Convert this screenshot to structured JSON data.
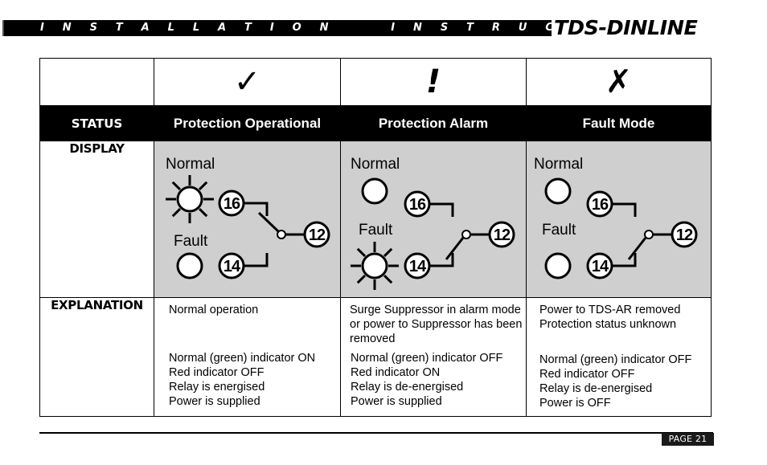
{
  "header": {
    "title": "I N S T A L L A T I O N     I N S T R U C T I O N S",
    "brand": "TDS-DINLINE"
  },
  "table": {
    "row_labels": {
      "status": "STATUS",
      "display": "DISPLAY",
      "explanation": "EXPLANATION"
    },
    "columns": [
      {
        "icon": "check-mark-icon",
        "icon_glyph": "✓",
        "status": "Protection Operational",
        "display": {
          "normal_label": "Normal",
          "fault_label": "Fault",
          "normal_indicator": "on",
          "fault_indicator": "off",
          "relay_contact": "16-12",
          "terminals": [
            "16",
            "12",
            "14"
          ]
        },
        "explanation": {
          "summary": [
            "Normal operation"
          ],
          "details": [
            "Normal (green) indicator ON",
            "Red indicator OFF",
            "Relay is energised",
            "Power is supplied"
          ]
        }
      },
      {
        "icon": "exclamation-icon",
        "icon_glyph": "!",
        "status": "Protection Alarm",
        "display": {
          "normal_label": "Normal",
          "fault_label": "Fault",
          "normal_indicator": "off",
          "fault_indicator": "on",
          "relay_contact": "14-12",
          "terminals": [
            "16",
            "12",
            "14"
          ]
        },
        "explanation": {
          "summary": [
            "Surge Suppressor in alarm mode",
            "or power to Suppressor has been",
            "removed"
          ],
          "details": [
            "Normal (green) indicator OFF",
            "Red indicator ON",
            "Relay is de-energised",
            "Power is supplied"
          ]
        }
      },
      {
        "icon": "cross-mark-icon",
        "icon_glyph": "✗",
        "status": "Fault Mode",
        "display": {
          "normal_label": "Normal",
          "fault_label": "Fault",
          "normal_indicator": "off",
          "fault_indicator": "off",
          "relay_contact": "14-12",
          "terminals": [
            "16",
            "12",
            "14"
          ]
        },
        "explanation": {
          "summary": [
            "Power to TDS-AR removed",
            "Protection status unknown"
          ],
          "details": [
            "Normal (green) indicator OFF",
            "Red indicator OFF",
            "Relay is de-energised",
            "Power is OFF"
          ]
        }
      }
    ]
  },
  "footer": {
    "page_label": "PAGE 21"
  }
}
